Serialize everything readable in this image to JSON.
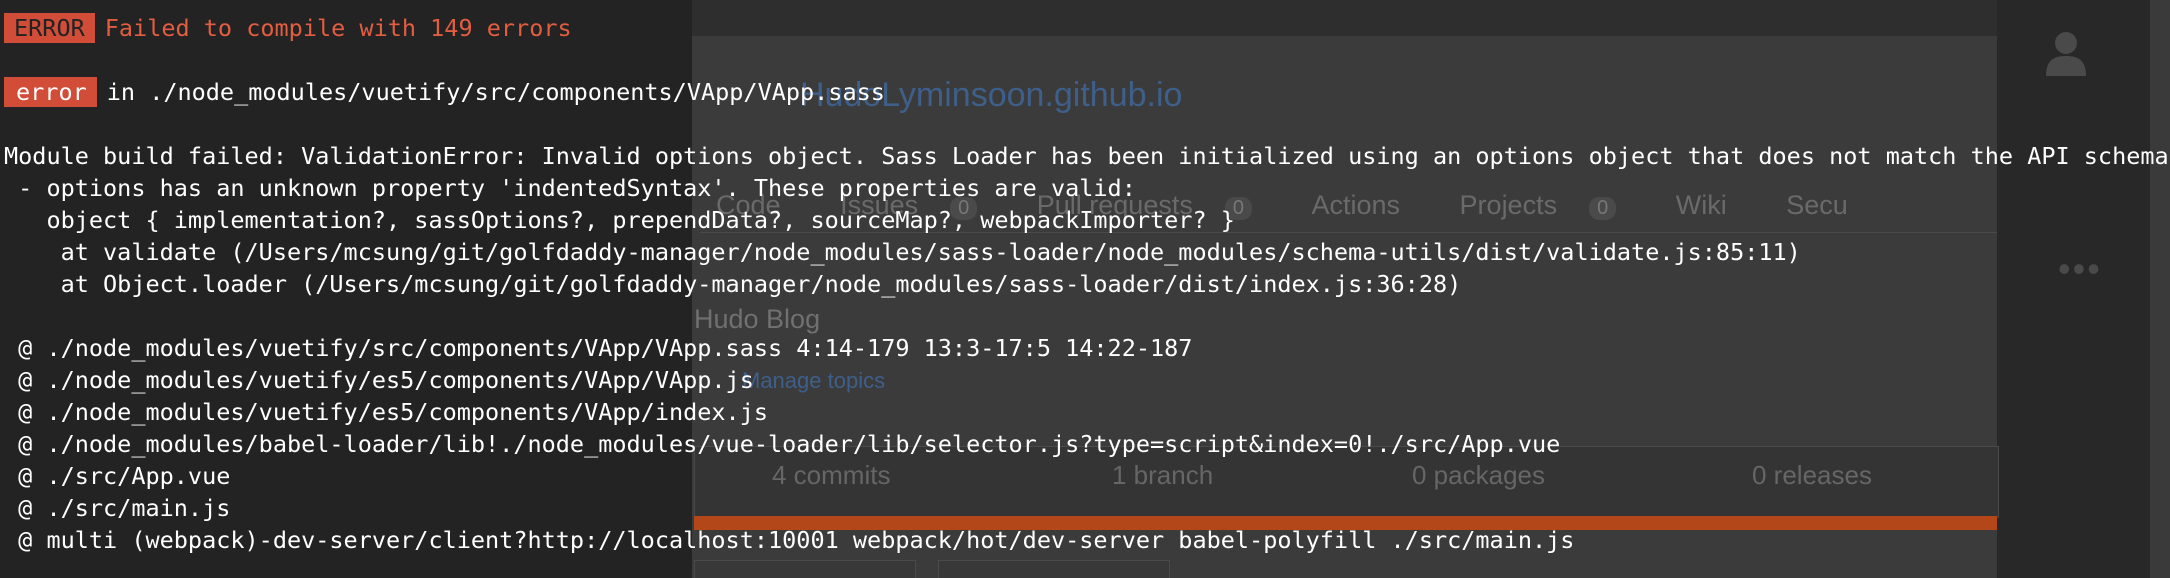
{
  "background": {
    "repo_title": "HudoLyminsoon.github.io",
    "tabs": [
      {
        "label": "Code",
        "count": ""
      },
      {
        "label": "Issues",
        "count": "0"
      },
      {
        "label": "Pull requests",
        "count": "0"
      },
      {
        "label": "Actions",
        "count": ""
      },
      {
        "label": "Projects",
        "count": "0"
      },
      {
        "label": "Wiki",
        "count": ""
      },
      {
        "label": "Secu",
        "count": ""
      }
    ],
    "description": "Hudo Blog",
    "topics_link": "Manage topics",
    "stats": {
      "commits": "4 commits",
      "branch": "1 branch",
      "packages": "0 packages",
      "releases": "0 releases"
    },
    "more_dots": "•••"
  },
  "error_overlay": {
    "header_badge": "ERROR",
    "header_message": "Failed to compile with 149 errors",
    "error_badge": "error",
    "error_location": "in ./node_modules/vuetify/src/components/VApp/VApp.sass",
    "message_lines": [
      "Module build failed: ValidationError: Invalid options object. Sass Loader has been initialized using an options object that does not match the API schema.",
      " - options has an unknown property 'indentedSyntax'. These properties are valid:",
      "   object { implementation?, sassOptions?, prependData?, sourceMap?, webpackImporter? }",
      "    at validate (/Users/mcsung/git/golfdaddy-manager/node_modules/sass-loader/node_modules/schema-utils/dist/validate.js:85:11)",
      "    at Object.loader (/Users/mcsung/git/golfdaddy-manager/node_modules/sass-loader/dist/index.js:36:28)"
    ],
    "stack_lines": [
      " @ ./node_modules/vuetify/src/components/VApp/VApp.sass 4:14-179 13:3-17:5 14:22-187",
      " @ ./node_modules/vuetify/es5/components/VApp/VApp.js",
      " @ ./node_modules/vuetify/es5/components/VApp/index.js",
      " @ ./node_modules/babel-loader/lib!./node_modules/vue-loader/lib/selector.js?type=script&index=0!./src/App.vue",
      " @ ./src/App.vue",
      " @ ./src/main.js",
      " @ multi (webpack)-dev-server/client?http://localhost:10001 webpack/hot/dev-server babel-polyfill ./src/main.js"
    ]
  },
  "colors": {
    "badge_red": "#d14d38",
    "title_red": "#e35d40",
    "text": "#ffffff"
  }
}
